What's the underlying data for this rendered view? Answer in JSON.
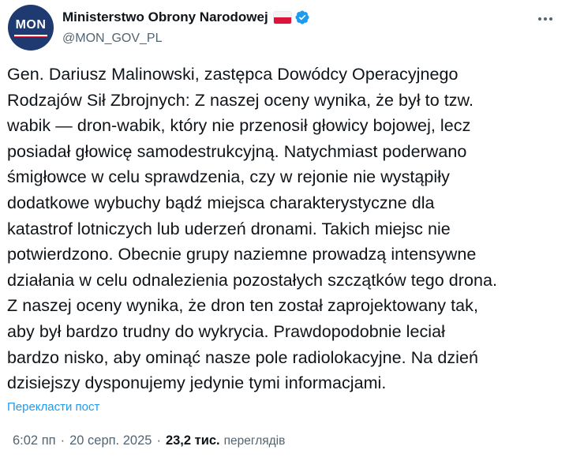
{
  "author": {
    "avatar_text": "MON",
    "display_name": "Ministerstwo Obrony Narodowej",
    "handle": "@MON_GOV_PL",
    "flag_icon": "poland-flag-icon",
    "verified_icon": "verified-badge-icon",
    "verified_color": "#1d9bf0"
  },
  "tweet": {
    "lines": [
      "Gen. Dariusz Malinowski, zastępca Dowódcy Operacyjnego",
      "Rodzajów Sił Zbrojnych: Z naszej oceny wynika, że był to tzw.",
      "wabik — dron-wabik, który nie przenosił głowicy bojowej, lecz",
      "posiadał głowicę samodestrukcyjną. Natychmiast poderwano",
      "śmigłowce w celu sprawdzenia, czy w rejonie nie wystąpiły",
      "dodatkowe wybuchy bądź miejsca charakterystyczne dla",
      "katastrof lotniczych lub uderzeń dronami. Takich miejsc nie",
      "potwierdzono. Obecnie grupy naziemne prowadzą intensywne",
      "działania w celu odnalezienia pozostałych szczątków tego drona.",
      "Z naszej oceny wynika, że dron ten został zaprojektowany tak,",
      "aby był bardzo trudny do wykrycia. Prawdopodobnie leciał",
      "bardzo nisko, aby ominąć nasze pole radiolokacyjne. Na dzień",
      "dzisiejszy dysponujemy jedynie tymi informacjami."
    ],
    "translate_label": "Перекласти пост"
  },
  "meta": {
    "time": "6:02 пп",
    "separator": "·",
    "date": "20 серп. 2025",
    "views_count": "23,2 тис.",
    "views_label": "переглядів"
  },
  "icons": {
    "more": "more-options-icon"
  }
}
